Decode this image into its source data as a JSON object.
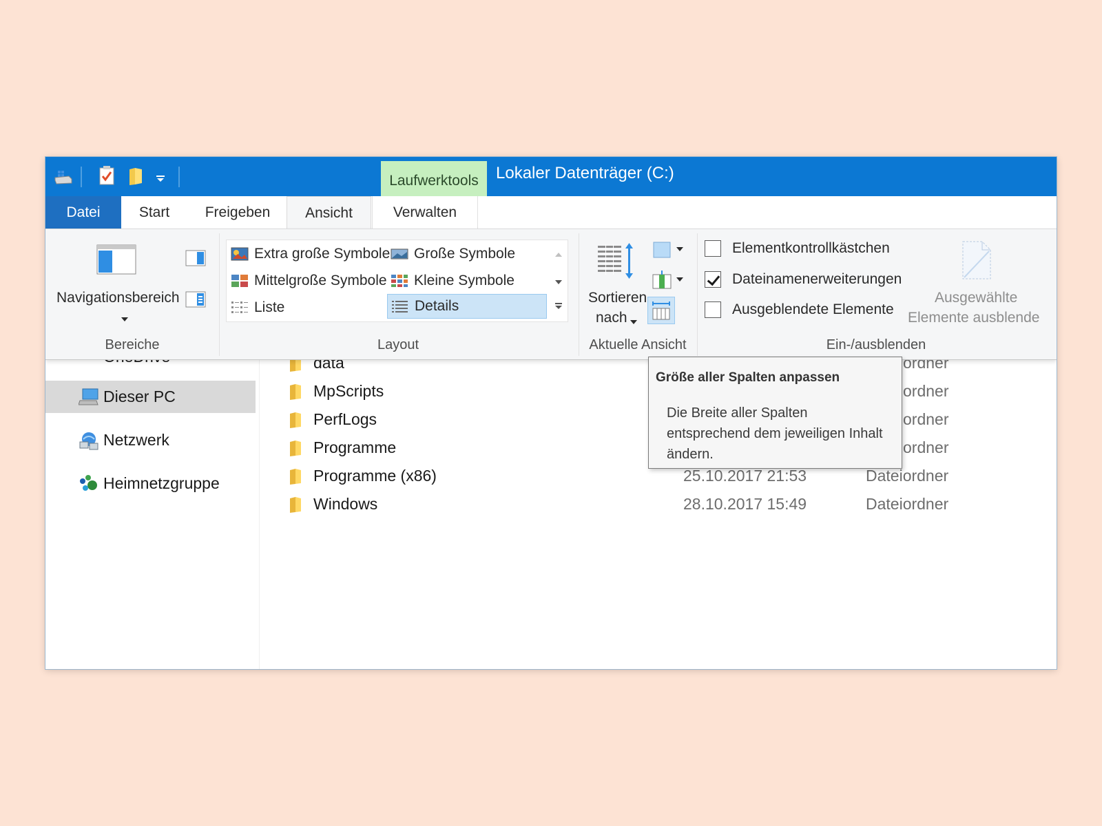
{
  "window": {
    "title": "Lokaler Datenträger (C:)",
    "context_tab": "Laufwerktools"
  },
  "tabs": {
    "file": "Datei",
    "start": "Start",
    "share": "Freigeben",
    "view": "Ansicht",
    "manage": "Verwalten"
  },
  "ribbon": {
    "panes": {
      "nav_pane": "Navigationsbereich",
      "label": "Bereiche"
    },
    "layout": {
      "items": [
        "Extra große Symbole",
        "Große Symbole",
        "Mittelgroße Symbole",
        "Kleine Symbole",
        "Liste",
        "Details"
      ],
      "selected": "Details",
      "label": "Layout"
    },
    "current_view": {
      "sort_line1": "Sortieren",
      "sort_line2": "nach",
      "label": "Aktuelle Ansicht"
    },
    "show_hide": {
      "item_checkboxes": "Elementkontrollkästchen",
      "item_checkboxes_checked": false,
      "extensions": "Dateinamenerweiterungen",
      "extensions_checked": true,
      "hidden_items": "Ausgeblendete Elemente",
      "hidden_items_checked": false,
      "hide_selected_line1": "Ausgewählte",
      "hide_selected_line2": "Elemente ausblende",
      "label": "Ein-/ausblenden"
    }
  },
  "sidebar": {
    "onedrive_partial": "OneDrive",
    "items": [
      "Dieser PC",
      "Netzwerk",
      "Heimnetzgruppe"
    ]
  },
  "files": [
    {
      "name": "data",
      "date": "",
      "type": "ordner"
    },
    {
      "name": "MpScripts",
      "date": "",
      "type": "ordner"
    },
    {
      "name": "PerfLogs",
      "date": "",
      "type": "ordner"
    },
    {
      "name": "Programme",
      "date": "",
      "type": "ordner"
    },
    {
      "name": "Programme (x86)",
      "date": "25.10.2017 21:53",
      "type": "Dateiordner"
    },
    {
      "name": "Windows",
      "date": "28.10.2017 15:49",
      "type": "Dateiordner"
    }
  ],
  "tooltip": {
    "title": "Größe aller Spalten anpassen",
    "body": "Die Breite aller Spalten entsprechend dem jeweiligen Inhalt ändern."
  },
  "colors": {
    "titlebar": "#0c78d3",
    "context_tab": "#c6efbf",
    "background": "#fde3d4",
    "selection": "#cce4f7"
  }
}
